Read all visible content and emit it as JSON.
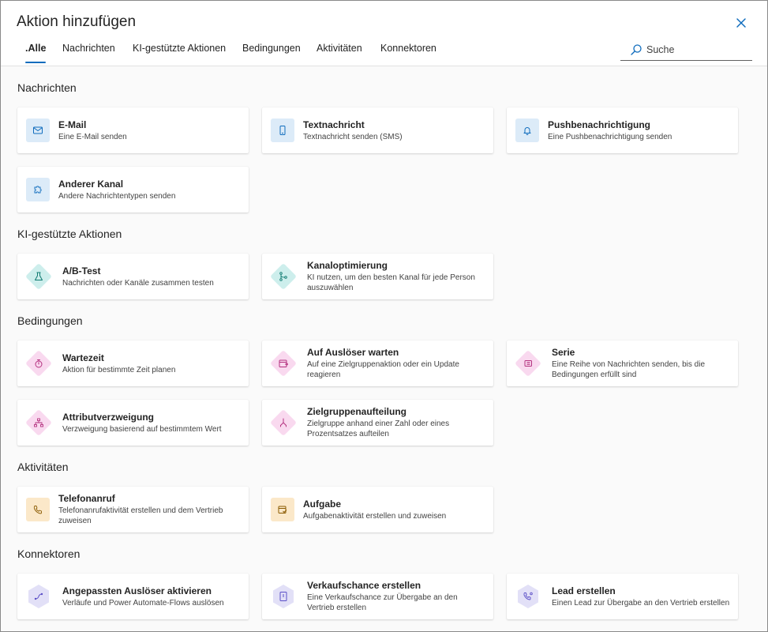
{
  "dialog": {
    "title": "Aktion hinzufügen",
    "search_placeholder": "Suche"
  },
  "tabs": [
    {
      "label": ".Alle",
      "active": true
    },
    {
      "label": "Nachrichten"
    },
    {
      "label": "KI-gestützte Aktionen"
    },
    {
      "label": "Bedingungen"
    },
    {
      "label": "Aktivitäten"
    },
    {
      "label": "Konnektoren"
    }
  ],
  "sections": {
    "messages": {
      "title": "Nachrichten",
      "cards": [
        {
          "name": "E-Mail",
          "desc": "Eine E-Mail senden",
          "icon": "mail-icon"
        },
        {
          "name": "Textnachricht",
          "desc": "Textnachricht senden (SMS)",
          "icon": "phone-icon"
        },
        {
          "name": "Pushbenachrichtigung",
          "desc": "Eine Pushbenachrichtigung senden",
          "icon": "bell-icon"
        },
        {
          "name": "Anderer Kanal",
          "desc": "Andere Nachrichtentypen senden",
          "icon": "puzzle-icon"
        }
      ]
    },
    "ai": {
      "title": "KI-gestützte Aktionen",
      "cards": [
        {
          "name": "A/B-Test",
          "desc": "Nachrichten oder Kanäle zusammen testen",
          "icon": "beaker-icon"
        },
        {
          "name": "Kanaloptimierung",
          "desc": "KI nutzen, um den besten Kanal für jede Person auszuwählen",
          "icon": "branch-icon"
        }
      ]
    },
    "conditions": {
      "title": "Bedingungen",
      "cards": [
        {
          "name": "Wartezeit",
          "desc": "Aktion für bestimmte Zeit planen",
          "icon": "timer-icon"
        },
        {
          "name": "Auf Auslöser warten",
          "desc": "Auf eine Zielgruppenaktion oder ein Update reagieren",
          "icon": "calendar-trigger-icon"
        },
        {
          "name": "Serie",
          "desc": "Eine Reihe von Nachrichten senden, bis die Bedingungen erfüllt sind",
          "icon": "list-icon"
        },
        {
          "name": "Attributverzweigung",
          "desc": "Verzweigung basierend auf bestimmtem Wert",
          "icon": "org-chart-icon"
        },
        {
          "name": "Zielgruppenaufteilung",
          "desc": "Zielgruppe anhand einer Zahl oder eines Prozentsatzes aufteilen",
          "icon": "split-icon"
        }
      ]
    },
    "activities": {
      "title": "Aktivitäten",
      "cards": [
        {
          "name": "Telefonanruf",
          "desc": "Telefonanrufaktivität erstellen und dem Vertrieb zuweisen",
          "icon": "call-icon"
        },
        {
          "name": "Aufgabe",
          "desc": "Aufgabenaktivität erstellen und zuweisen",
          "icon": "task-icon"
        }
      ]
    },
    "connectors": {
      "title": "Konnektoren",
      "cards": [
        {
          "name": "Angepassten Auslöser aktivieren",
          "desc": "Verläufe und Power Automate-Flows auslösen",
          "icon": "flow-icon"
        },
        {
          "name": "Verkaufschance erstellen",
          "desc": "Eine Verkaufschance zur Übergabe an den Vertrieb erstellen",
          "icon": "opportunity-icon"
        },
        {
          "name": "Lead erstellen",
          "desc": "Einen Lead zur Übergabe an den Vertrieb erstellen",
          "icon": "lead-icon"
        }
      ]
    }
  },
  "colors": {
    "accent": "#0f6cbd",
    "message_icon_bg": "#dcebf8",
    "ai_icon_bg": "#cdeeec",
    "condition_icon_bg": "#f9d9ef",
    "activity_icon_bg": "#fbe8c9",
    "connector_icon_bg": "#e2e0f7"
  }
}
